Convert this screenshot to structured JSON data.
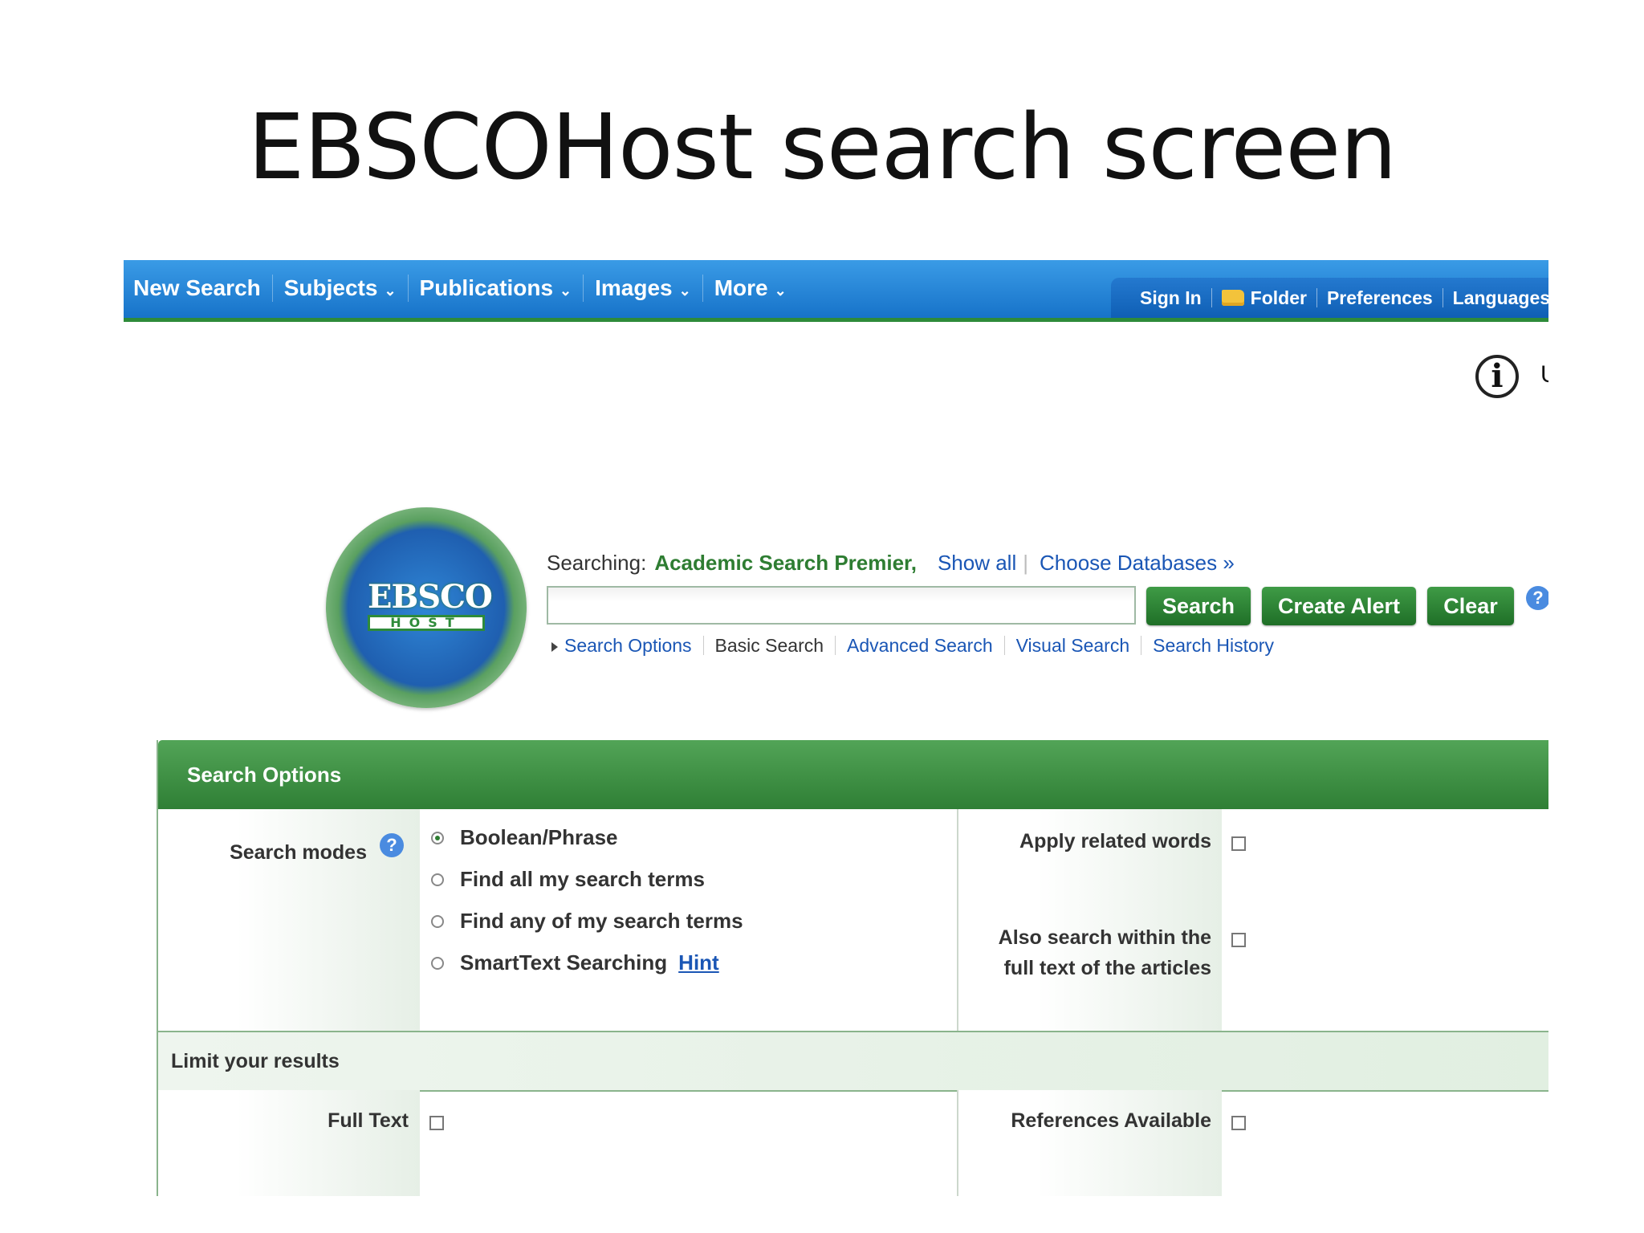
{
  "slide": {
    "title": "EBSCOHost search screen"
  },
  "topnav": {
    "items": [
      {
        "label": "New Search",
        "dropdown": false
      },
      {
        "label": "Subjects",
        "dropdown": true
      },
      {
        "label": "Publications",
        "dropdown": true
      },
      {
        "label": "Images",
        "dropdown": true
      },
      {
        "label": "More",
        "dropdown": true
      }
    ],
    "chevron": "⌄"
  },
  "utilnav": {
    "sign_in": "Sign In",
    "folder": "Folder",
    "preferences": "Preferences",
    "languages": "Languages"
  },
  "info": {
    "glyph": "i",
    "cut_text": "U"
  },
  "logo": {
    "top": "EBSCO",
    "bottom": "HOST"
  },
  "searching": {
    "label": "Searching:",
    "database": "Academic Search Premier,",
    "show_all": "Show all",
    "choose_databases": "Choose Databases »"
  },
  "search": {
    "value": "",
    "placeholder": ""
  },
  "buttons": {
    "search": "Search",
    "create_alert": "Create Alert",
    "clear": "Clear",
    "help": "?"
  },
  "subnav": {
    "search_options": "Search Options",
    "basic": "Basic Search",
    "advanced": "Advanced Search",
    "visual": "Visual Search",
    "history": "Search History"
  },
  "options": {
    "title": "Search Options",
    "search_modes_label": "Search modes",
    "help": "?",
    "modes": [
      {
        "label": "Boolean/Phrase",
        "selected": true
      },
      {
        "label": "Find all my search terms",
        "selected": false
      },
      {
        "label": "Find any of my search terms",
        "selected": false
      },
      {
        "label": "SmartText Searching",
        "selected": false
      }
    ],
    "hint": "Hint",
    "apply_related": "Apply related words",
    "also_search_line1": "Also search within the",
    "also_search_line2": "full text of the articles"
  },
  "limits": {
    "title": "Limit your results",
    "full_text": "Full Text",
    "references": "References Available"
  },
  "colors": {
    "nav_blue": "#1773c9",
    "accent_green": "#2e7d32",
    "link_blue": "#1a56b5"
  }
}
